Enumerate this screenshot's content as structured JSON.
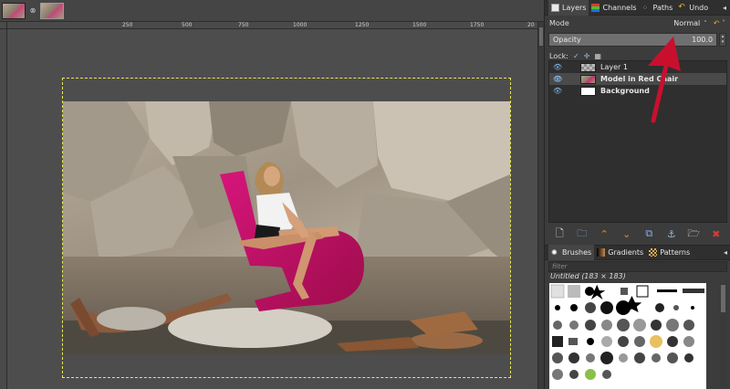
{
  "image_tabs": [
    {
      "name": "image-tab-1",
      "active": false
    },
    {
      "name": "image-tab-2",
      "active": true
    }
  ],
  "ruler": {
    "ticks": [
      "250",
      "500",
      "750",
      "1000",
      "1250",
      "1500",
      "1750",
      "20"
    ]
  },
  "dock": {
    "tabs": [
      {
        "label": "Layers",
        "icon": "layers-icon",
        "active": true
      },
      {
        "label": "Channels",
        "icon": "channels-icon",
        "active": false
      },
      {
        "label": "Paths",
        "icon": "paths-icon",
        "active": false
      },
      {
        "label": "Undo",
        "icon": "undo-icon",
        "active": false
      }
    ],
    "mode_label": "Mode",
    "mode_value": "Normal",
    "opacity_label": "Opacity",
    "opacity_value": "100.0",
    "opacity_fraction": 1.0,
    "lock_label": "Lock:",
    "layers": [
      {
        "name": "Layer 1",
        "thumb": "checker",
        "active": false
      },
      {
        "name": "Model in Red Chair",
        "thumb": "photo",
        "active": true
      },
      {
        "name": "Background",
        "thumb": "white",
        "active": false
      }
    ],
    "layer_actions": [
      {
        "name": "new-layer-icon",
        "glyph": "🗋",
        "color": "#e6e6e6"
      },
      {
        "name": "new-layer-group-icon",
        "glyph": "🗀",
        "color": "#7db2e8"
      },
      {
        "name": "raise-layer-icon",
        "glyph": "⌃",
        "color": "#f08a24"
      },
      {
        "name": "lower-layer-icon",
        "glyph": "⌄",
        "color": "#f08a24"
      },
      {
        "name": "duplicate-layer-icon",
        "glyph": "⧉",
        "color": "#7db2e8"
      },
      {
        "name": "anchor-layer-icon",
        "glyph": "⚓",
        "color": "#9bbad6"
      },
      {
        "name": "merge-layer-icon",
        "glyph": "🗁",
        "color": "#dcdcdc"
      },
      {
        "name": "delete-layer-icon",
        "glyph": "✖",
        "color": "#d63a3a"
      }
    ]
  },
  "brushes": {
    "tabs": [
      {
        "label": "Brushes",
        "icon": "brushes-icon",
        "active": true
      },
      {
        "label": "Gradients",
        "icon": "gradients-icon",
        "active": false
      },
      {
        "label": "Patterns",
        "icon": "patterns-icon",
        "active": false
      }
    ],
    "filter_placeholder": "filter",
    "current_brush": "Untitled (183 × 183)"
  },
  "colors": {
    "accent_arrow": "#c8102e",
    "chair": "#c0125f"
  }
}
